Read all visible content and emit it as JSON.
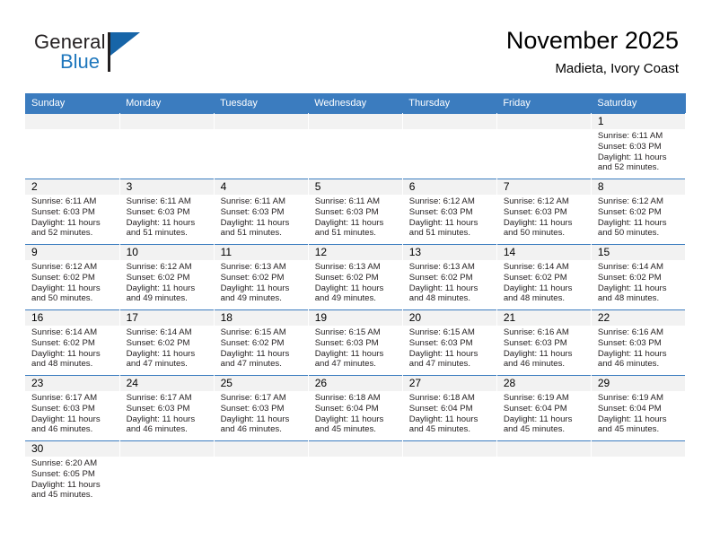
{
  "brand": {
    "name_top": "General",
    "name_bottom": "Blue",
    "color_blue": "#1f77bd",
    "color_dark": "#231f20"
  },
  "header": {
    "title": "November 2025",
    "subtitle": "Madieta, Ivory Coast"
  },
  "theme": {
    "header_row_bg": "#3b7cbf",
    "header_row_text": "#ffffff",
    "daynum_band_bg": "#f2f2f2",
    "grid_line": "#3b7cbf"
  },
  "weekdays": [
    "Sunday",
    "Monday",
    "Tuesday",
    "Wednesday",
    "Thursday",
    "Friday",
    "Saturday"
  ],
  "labels": {
    "sunrise_prefix": "Sunrise:",
    "sunset_prefix": "Sunset:",
    "daylight_prefix": "Daylight:"
  },
  "weeks": [
    [
      {
        "day": "",
        "blank": true
      },
      {
        "day": "",
        "blank": true
      },
      {
        "day": "",
        "blank": true
      },
      {
        "day": "",
        "blank": true
      },
      {
        "day": "",
        "blank": true
      },
      {
        "day": "",
        "blank": true
      },
      {
        "day": "1",
        "sunrise": "Sunrise: 6:11 AM",
        "sunset": "Sunset: 6:03 PM",
        "daylight": "Daylight: 11 hours and 52 minutes."
      }
    ],
    [
      {
        "day": "2",
        "sunrise": "Sunrise: 6:11 AM",
        "sunset": "Sunset: 6:03 PM",
        "daylight": "Daylight: 11 hours and 52 minutes."
      },
      {
        "day": "3",
        "sunrise": "Sunrise: 6:11 AM",
        "sunset": "Sunset: 6:03 PM",
        "daylight": "Daylight: 11 hours and 51 minutes."
      },
      {
        "day": "4",
        "sunrise": "Sunrise: 6:11 AM",
        "sunset": "Sunset: 6:03 PM",
        "daylight": "Daylight: 11 hours and 51 minutes."
      },
      {
        "day": "5",
        "sunrise": "Sunrise: 6:11 AM",
        "sunset": "Sunset: 6:03 PM",
        "daylight": "Daylight: 11 hours and 51 minutes."
      },
      {
        "day": "6",
        "sunrise": "Sunrise: 6:12 AM",
        "sunset": "Sunset: 6:03 PM",
        "daylight": "Daylight: 11 hours and 51 minutes."
      },
      {
        "day": "7",
        "sunrise": "Sunrise: 6:12 AM",
        "sunset": "Sunset: 6:03 PM",
        "daylight": "Daylight: 11 hours and 50 minutes."
      },
      {
        "day": "8",
        "sunrise": "Sunrise: 6:12 AM",
        "sunset": "Sunset: 6:02 PM",
        "daylight": "Daylight: 11 hours and 50 minutes."
      }
    ],
    [
      {
        "day": "9",
        "sunrise": "Sunrise: 6:12 AM",
        "sunset": "Sunset: 6:02 PM",
        "daylight": "Daylight: 11 hours and 50 minutes."
      },
      {
        "day": "10",
        "sunrise": "Sunrise: 6:12 AM",
        "sunset": "Sunset: 6:02 PM",
        "daylight": "Daylight: 11 hours and 49 minutes."
      },
      {
        "day": "11",
        "sunrise": "Sunrise: 6:13 AM",
        "sunset": "Sunset: 6:02 PM",
        "daylight": "Daylight: 11 hours and 49 minutes."
      },
      {
        "day": "12",
        "sunrise": "Sunrise: 6:13 AM",
        "sunset": "Sunset: 6:02 PM",
        "daylight": "Daylight: 11 hours and 49 minutes."
      },
      {
        "day": "13",
        "sunrise": "Sunrise: 6:13 AM",
        "sunset": "Sunset: 6:02 PM",
        "daylight": "Daylight: 11 hours and 48 minutes."
      },
      {
        "day": "14",
        "sunrise": "Sunrise: 6:14 AM",
        "sunset": "Sunset: 6:02 PM",
        "daylight": "Daylight: 11 hours and 48 minutes."
      },
      {
        "day": "15",
        "sunrise": "Sunrise: 6:14 AM",
        "sunset": "Sunset: 6:02 PM",
        "daylight": "Daylight: 11 hours and 48 minutes."
      }
    ],
    [
      {
        "day": "16",
        "sunrise": "Sunrise: 6:14 AM",
        "sunset": "Sunset: 6:02 PM",
        "daylight": "Daylight: 11 hours and 48 minutes."
      },
      {
        "day": "17",
        "sunrise": "Sunrise: 6:14 AM",
        "sunset": "Sunset: 6:02 PM",
        "daylight": "Daylight: 11 hours and 47 minutes."
      },
      {
        "day": "18",
        "sunrise": "Sunrise: 6:15 AM",
        "sunset": "Sunset: 6:02 PM",
        "daylight": "Daylight: 11 hours and 47 minutes."
      },
      {
        "day": "19",
        "sunrise": "Sunrise: 6:15 AM",
        "sunset": "Sunset: 6:03 PM",
        "daylight": "Daylight: 11 hours and 47 minutes."
      },
      {
        "day": "20",
        "sunrise": "Sunrise: 6:15 AM",
        "sunset": "Sunset: 6:03 PM",
        "daylight": "Daylight: 11 hours and 47 minutes."
      },
      {
        "day": "21",
        "sunrise": "Sunrise: 6:16 AM",
        "sunset": "Sunset: 6:03 PM",
        "daylight": "Daylight: 11 hours and 46 minutes."
      },
      {
        "day": "22",
        "sunrise": "Sunrise: 6:16 AM",
        "sunset": "Sunset: 6:03 PM",
        "daylight": "Daylight: 11 hours and 46 minutes."
      }
    ],
    [
      {
        "day": "23",
        "sunrise": "Sunrise: 6:17 AM",
        "sunset": "Sunset: 6:03 PM",
        "daylight": "Daylight: 11 hours and 46 minutes."
      },
      {
        "day": "24",
        "sunrise": "Sunrise: 6:17 AM",
        "sunset": "Sunset: 6:03 PM",
        "daylight": "Daylight: 11 hours and 46 minutes."
      },
      {
        "day": "25",
        "sunrise": "Sunrise: 6:17 AM",
        "sunset": "Sunset: 6:03 PM",
        "daylight": "Daylight: 11 hours and 46 minutes."
      },
      {
        "day": "26",
        "sunrise": "Sunrise: 6:18 AM",
        "sunset": "Sunset: 6:04 PM",
        "daylight": "Daylight: 11 hours and 45 minutes."
      },
      {
        "day": "27",
        "sunrise": "Sunrise: 6:18 AM",
        "sunset": "Sunset: 6:04 PM",
        "daylight": "Daylight: 11 hours and 45 minutes."
      },
      {
        "day": "28",
        "sunrise": "Sunrise: 6:19 AM",
        "sunset": "Sunset: 6:04 PM",
        "daylight": "Daylight: 11 hours and 45 minutes."
      },
      {
        "day": "29",
        "sunrise": "Sunrise: 6:19 AM",
        "sunset": "Sunset: 6:04 PM",
        "daylight": "Daylight: 11 hours and 45 minutes."
      }
    ],
    [
      {
        "day": "30",
        "sunrise": "Sunrise: 6:20 AM",
        "sunset": "Sunset: 6:05 PM",
        "daylight": "Daylight: 11 hours and 45 minutes."
      },
      {
        "day": "",
        "blank": true
      },
      {
        "day": "",
        "blank": true
      },
      {
        "day": "",
        "blank": true
      },
      {
        "day": "",
        "blank": true
      },
      {
        "day": "",
        "blank": true
      },
      {
        "day": "",
        "blank": true
      }
    ]
  ]
}
